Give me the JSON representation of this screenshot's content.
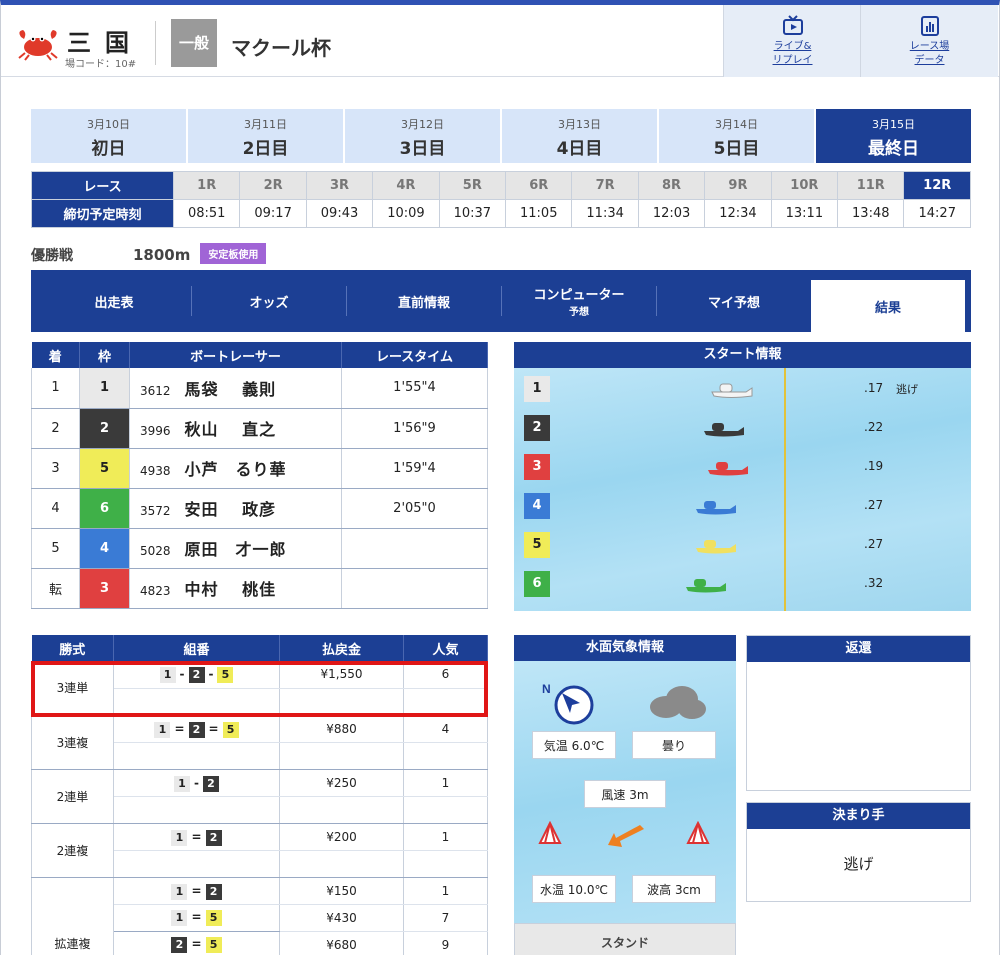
{
  "header": {
    "venue": "三国",
    "code": "場コード：10#",
    "grade": "一般",
    "race_title": "マクール杯",
    "btn_live": [
      "ライブ&",
      "リプレイ"
    ],
    "btn_data": [
      "レース場",
      "データ"
    ]
  },
  "days": [
    {
      "date": "3月10日",
      "name": "初日"
    },
    {
      "date": "3月11日",
      "name": "2日目"
    },
    {
      "date": "3月12日",
      "name": "3日目"
    },
    {
      "date": "3月13日",
      "name": "4日目"
    },
    {
      "date": "3月14日",
      "name": "5日目"
    },
    {
      "date": "3月15日",
      "name": "最終日"
    }
  ],
  "race_row_label": "レース",
  "time_row_label": "締切予定時刻",
  "races": [
    "1R",
    "2R",
    "3R",
    "4R",
    "5R",
    "6R",
    "7R",
    "8R",
    "9R",
    "10R",
    "11R",
    "12R"
  ],
  "times": [
    "08:51",
    "09:17",
    "09:43",
    "10:09",
    "10:37",
    "11:05",
    "11:34",
    "12:03",
    "12:34",
    "13:11",
    "13:48",
    "14:27"
  ],
  "race_info": {
    "name": "優勝戦",
    "distance": "1800m",
    "badge": "安定板使用"
  },
  "nav": [
    {
      "label": "出走表",
      "sub": ""
    },
    {
      "label": "オッズ",
      "sub": ""
    },
    {
      "label": "直前情報",
      "sub": ""
    },
    {
      "label": "コンピューター",
      "sub": "予想"
    },
    {
      "label": "マイ予想",
      "sub": ""
    },
    {
      "label": "結果",
      "sub": ""
    }
  ],
  "result": {
    "headers": [
      "着",
      "枠",
      "ボートレーサー",
      "レースタイム"
    ],
    "rows": [
      {
        "rank": "1",
        "waku": "1",
        "reg": "3612",
        "name": "馬袋　 義則",
        "time": "1'55\"4"
      },
      {
        "rank": "2",
        "waku": "2",
        "reg": "3996",
        "name": "秋山　 直之",
        "time": "1'56\"9"
      },
      {
        "rank": "3",
        "waku": "5",
        "reg": "4938",
        "name": "小芦　るり華",
        "time": "1'59\"4"
      },
      {
        "rank": "4",
        "waku": "6",
        "reg": "3572",
        "name": "安田　 政彦",
        "time": "2'05\"0"
      },
      {
        "rank": "5",
        "waku": "4",
        "reg": "5028",
        "name": "原田　才一郎",
        "time": ""
      },
      {
        "rank": "転",
        "waku": "3",
        "reg": "4823",
        "name": "中村　 桃佳",
        "time": ""
      }
    ]
  },
  "start": {
    "title": "スタート情報",
    "rows": [
      {
        "n": "1",
        "st": ".17",
        "kimarite": "逃げ"
      },
      {
        "n": "2",
        "st": ".22",
        "kimarite": ""
      },
      {
        "n": "3",
        "st": ".19",
        "kimarite": ""
      },
      {
        "n": "4",
        "st": ".27",
        "kimarite": ""
      },
      {
        "n": "5",
        "st": ".27",
        "kimarite": ""
      },
      {
        "n": "6",
        "st": ".32",
        "kimarite": ""
      }
    ]
  },
  "payout": {
    "headers": [
      "勝式",
      "組番",
      "払戻金",
      "人気"
    ],
    "rows": [
      {
        "type": "3連単",
        "combo": [
          "1",
          "-",
          "2",
          "-",
          "5"
        ],
        "amount": "¥1,550",
        "pop": "6"
      },
      {
        "type": "3連複",
        "combo": [
          "1",
          "=",
          "2",
          "=",
          "5"
        ],
        "amount": "¥880",
        "pop": "4"
      },
      {
        "type": "2連単",
        "combo": [
          "1",
          "-",
          "2"
        ],
        "amount": "¥250",
        "pop": "1"
      },
      {
        "type": "2連複",
        "combo": [
          "1",
          "=",
          "2"
        ],
        "amount": "¥200",
        "pop": "1"
      },
      {
        "type": "拡連複",
        "sub": [
          {
            "combo": [
              "1",
              "=",
              "2"
            ],
            "amount": "¥150",
            "pop": "1"
          },
          {
            "combo": [
              "1",
              "=",
              "5"
            ],
            "amount": "¥430",
            "pop": "7"
          },
          {
            "combo": [
              "2",
              "=",
              "5"
            ],
            "amount": "¥680",
            "pop": "9"
          }
        ]
      }
    ]
  },
  "weather": {
    "title": "水面気象情報",
    "air_temp": "気温 6.0℃",
    "weather": "曇り",
    "wind": "風速 3m",
    "water_temp": "水温 10.0℃",
    "wave": "波高 3cm",
    "stand": "スタンド",
    "north": "N"
  },
  "henkan": {
    "title": "返還"
  },
  "kimarite": {
    "title": "決まり手",
    "value": "逃げ"
  }
}
